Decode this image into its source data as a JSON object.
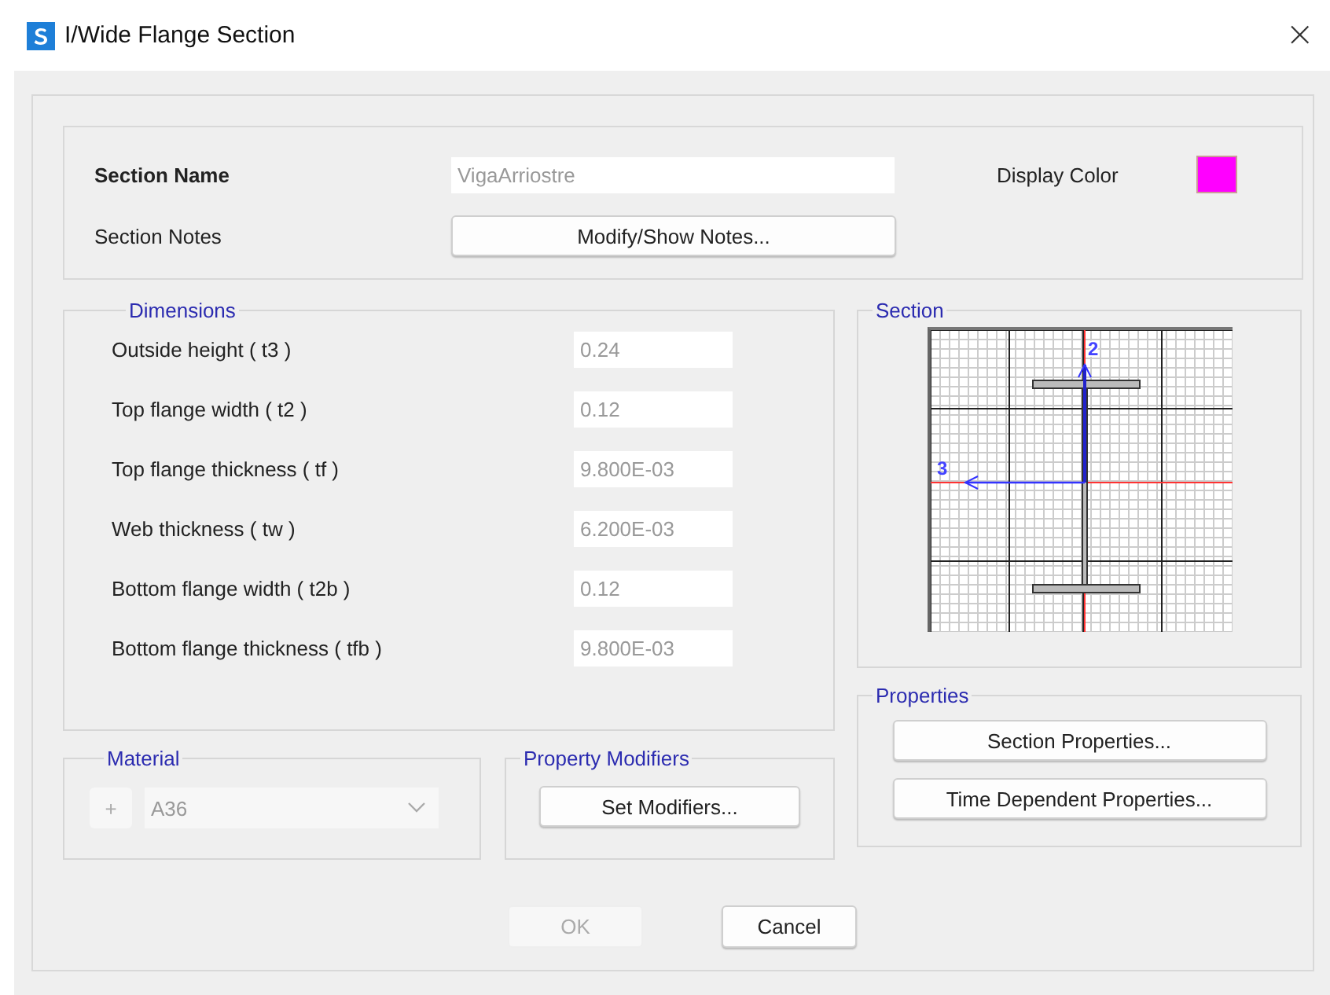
{
  "window": {
    "title": "I/Wide Flange Section",
    "close": "×"
  },
  "section_name": {
    "label": "Section Name",
    "value": "VigaArriostre",
    "disabled": true
  },
  "section_notes": {
    "label": "Section Notes",
    "button": "Modify/Show Notes..."
  },
  "display_color": {
    "label": "Display Color",
    "color": "#ff00ff"
  },
  "dimensions": {
    "title": "Dimensions",
    "rows": [
      {
        "label": "Outside height  ( t3 )",
        "value": "0.24",
        "disabled": true
      },
      {
        "label": "Top flange width  ( t2 )",
        "value": "0.12",
        "disabled": true
      },
      {
        "label": "Top flange thickness  ( tf )",
        "value": "9.800E-03",
        "disabled": true
      },
      {
        "label": "Web thickness  ( tw )",
        "value": "6.200E-03",
        "disabled": true
      },
      {
        "label": "Bottom flange width  ( t2b )",
        "value": "0.12",
        "disabled": true
      },
      {
        "label": "Bottom flange thickness  ( tfb )",
        "value": "9.800E-03",
        "disabled": true
      }
    ]
  },
  "section": {
    "title": "Section",
    "axis_2": "2",
    "axis_3": "3"
  },
  "properties": {
    "title": "Properties",
    "buttons": [
      "Section Properties...",
      "Time Dependent Properties..."
    ]
  },
  "material": {
    "title": "Material",
    "add": "+",
    "value": "A36",
    "disabled": true
  },
  "property_modifiers": {
    "title": "Property Modifiers",
    "button": "Set Modifiers..."
  },
  "footer": [
    {
      "label": "OK",
      "disabled": true
    },
    {
      "label": "Cancel",
      "disabled": false
    }
  ]
}
